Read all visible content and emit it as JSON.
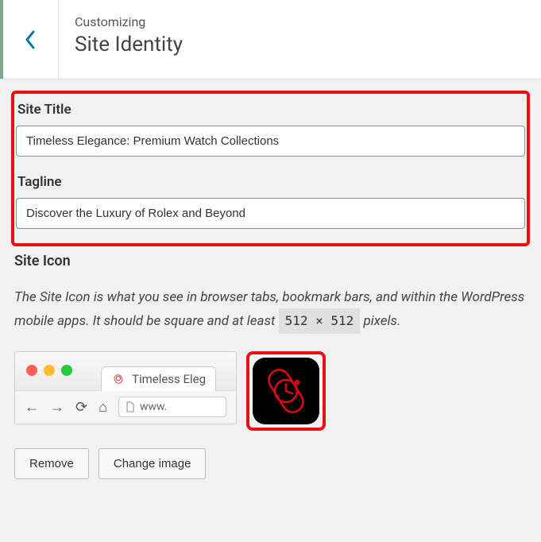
{
  "header": {
    "eyebrow": "Customizing",
    "title": "Site Identity"
  },
  "fields": {
    "site_title_label": "Site Title",
    "site_title_value": "Timeless Elegance: Premium Watch Collections",
    "tagline_label": "Tagline",
    "tagline_value": "Discover the Luxury of Rolex and Beyond"
  },
  "site_icon": {
    "label": "Site Icon",
    "desc_a": "The Site Icon is what you see in browser tabs, bookmark bars, and within the WordPress mobile apps. It should be square and at least ",
    "size": "512 × 512",
    "desc_b": " pixels."
  },
  "browser": {
    "tab_title": "Timeless Eleg",
    "url": "www."
  },
  "buttons": {
    "remove": "Remove",
    "change": "Change image"
  }
}
